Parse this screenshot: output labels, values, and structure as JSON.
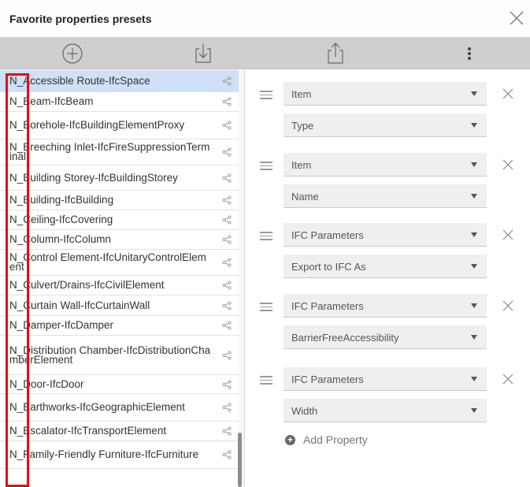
{
  "dialog": {
    "title": "Favorite properties presets"
  },
  "toolbar": {
    "icons": [
      "add-preset-icon",
      "import-icon",
      "export-icon",
      "more-options-icon"
    ]
  },
  "presets": [
    {
      "label": "N_Accessible Route-IfcSpace",
      "selected": true
    },
    {
      "label": "N_Beam-IfcBeam"
    },
    {
      "label": "N_Borehole-IfcBuildingElementProxy"
    },
    {
      "label": "N_Breeching Inlet-IfcFireSuppressionTerminal"
    },
    {
      "label": "N_Building Storey-IfcBuildingStorey"
    },
    {
      "label": "N_Building-IfcBuilding"
    },
    {
      "label": "N_Ceiling-IfcCovering"
    },
    {
      "label": "N_Column-IfcColumn"
    },
    {
      "label": "N_Control Element-IfcUnitaryControlElement"
    },
    {
      "label": "N_Culvert/Drains-IfcCivilElement"
    },
    {
      "label": "N_Curtain Wall-IfcCurtainWall"
    },
    {
      "label": "N_Damper-IfcDamper"
    },
    {
      "label": "N_Distribution Chamber-IfcDistributionChamberElement"
    },
    {
      "label": "N_Door-IfcDoor"
    },
    {
      "label": "N_Earthworks-IfcGeographicElement"
    },
    {
      "label": "N_Escalator-IfcTransportElement"
    },
    {
      "label": "N_Family-Friendly Furniture-IfcFurniture"
    }
  ],
  "properties": [
    {
      "group": "Item",
      "name": "Type"
    },
    {
      "group": "Item",
      "name": "Name"
    },
    {
      "group": "IFC Parameters",
      "name": "Export to IFC As"
    },
    {
      "group": "IFC Parameters",
      "name": "BarrierFreeAccessibility"
    },
    {
      "group": "IFC Parameters",
      "name": "Width"
    }
  ],
  "add_property_label": "Add Property",
  "colors": {
    "selection": "#cfe0f7",
    "toolbar": "#cfcfcf",
    "highlight": "#e01010"
  }
}
